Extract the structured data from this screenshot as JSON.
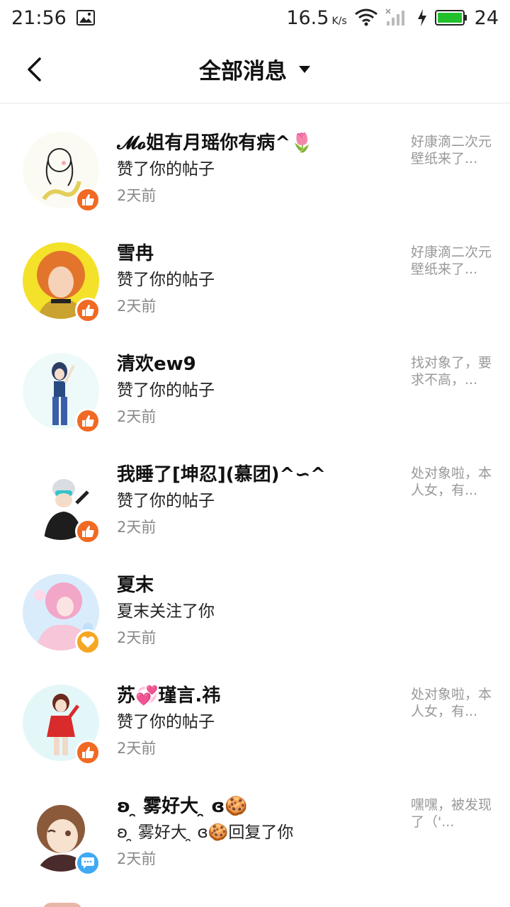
{
  "status_bar": {
    "time": "21:56",
    "speed": "16.5",
    "speed_unit": "K/s",
    "battery": "24",
    "icons": [
      "image-icon",
      "wifi-icon",
      "signal-icon",
      "charging-icon",
      "battery-icon"
    ]
  },
  "header": {
    "title": "全部消息",
    "back_icon": "chevron-left-icon",
    "dropdown_icon": "caret-down-icon"
  },
  "colors": {
    "like_badge": "#f06a23",
    "follow_badge": "#f5a623",
    "reply_badge": "#3fa9f5"
  },
  "messages": [
    {
      "name": "𝓜𝓸姐有月瑶你有病^🌷",
      "action": "赞了你的帖子",
      "time": "2天前",
      "preview": "好康滴二次元壁纸来了...",
      "badge": "like"
    },
    {
      "name": "雪冉",
      "action": "赞了你的帖子",
      "time": "2天前",
      "preview": "好康滴二次元壁纸来了...",
      "badge": "like"
    },
    {
      "name": "清欢ew9",
      "action": "赞了你的帖子",
      "time": "2天前",
      "preview": "找对象了，要求不高，...",
      "badge": "like"
    },
    {
      "name": "我睡了[坤忍](慕团)^∽^",
      "action": "赞了你的帖子",
      "time": "2天前",
      "preview": "处对象啦，本人女，有...",
      "badge": "like"
    },
    {
      "name": "夏末",
      "action": "夏末关注了你",
      "time": "2天前",
      "preview": "",
      "badge": "follow"
    },
    {
      "name": "苏💞瑾言.祎",
      "action": "赞了你的帖子",
      "time": "2天前",
      "preview": "处对象啦，本人女，有...",
      "badge": "like"
    },
    {
      "name": "ʚ ̯ 雾好大 ̯ ɞ🍪",
      "action": "ʚ ̯ 雾好大 ̯ ɞ🍪回复了你",
      "time": "2天前",
      "preview": "嘿嘿，被发现了（'...",
      "badge": "reply"
    }
  ]
}
